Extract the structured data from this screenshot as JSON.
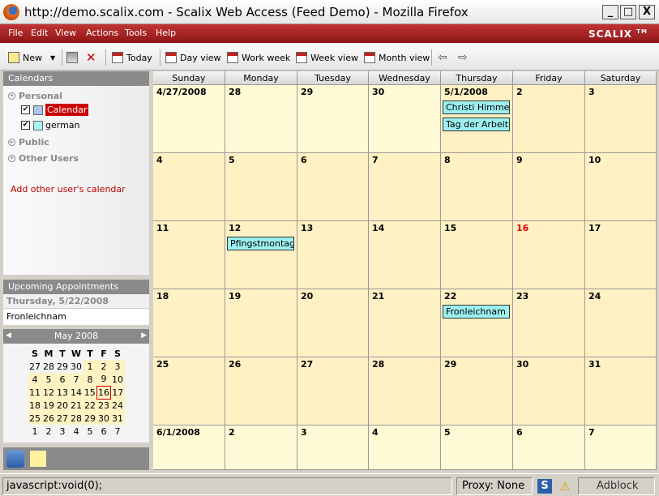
{
  "window": {
    "title": "http://demo.scalix.com - Scalix Web Access (Feed Demo) - Mozilla Firefox",
    "min": "_",
    "max": "□",
    "close": "X"
  },
  "menu": [
    "File",
    "Edit",
    "View",
    "Actions",
    "Tools",
    "Help"
  ],
  "brand": "SCALIX",
  "brand_tm": "TM",
  "toolbar": {
    "new": "New",
    "today": "Today",
    "day": "Day view",
    "workweek": "Work week",
    "week": "Week view",
    "month": "Month view"
  },
  "sidebar": {
    "header": "Calendars",
    "personal": "Personal",
    "calendars": [
      {
        "label": "Calendar",
        "color": "#a9c8ee"
      },
      {
        "label": "german",
        "color": "#a8f4f4"
      }
    ],
    "public": "Public",
    "other": "Other Users",
    "add_other": "Add other user's calendar"
  },
  "upcoming": {
    "header": "Upcoming Appointments",
    "date": "Thursday, 5/22/2008",
    "item": "Fronleichnam"
  },
  "mini_cal": {
    "month": "May 2008",
    "days": [
      "S",
      "M",
      "T",
      "W",
      "T",
      "F",
      "S"
    ],
    "weeks": [
      [
        "27",
        "28",
        "29",
        "30",
        "1",
        "2",
        "3"
      ],
      [
        "4",
        "5",
        "6",
        "7",
        "8",
        "9",
        "10"
      ],
      [
        "11",
        "12",
        "13",
        "14",
        "15",
        "16",
        "17"
      ],
      [
        "18",
        "19",
        "20",
        "21",
        "22",
        "23",
        "24"
      ],
      [
        "25",
        "26",
        "27",
        "28",
        "29",
        "30",
        "31"
      ],
      [
        "1",
        "2",
        "3",
        "4",
        "5",
        "6",
        "7"
      ]
    ]
  },
  "calendar": {
    "headers": [
      "Sunday",
      "Monday",
      "Tuesday",
      "Wednesday",
      "Thursday",
      "Friday",
      "Saturday"
    ],
    "weeks": [
      [
        "4/27/2008",
        "28",
        "29",
        "30",
        "5/1/2008",
        "2",
        "3"
      ],
      [
        "4",
        "5",
        "6",
        "7",
        "8",
        "9",
        "10"
      ],
      [
        "11",
        "12",
        "13",
        "14",
        "15",
        "16",
        "17"
      ],
      [
        "18",
        "19",
        "20",
        "21",
        "22",
        "23",
        "24"
      ],
      [
        "25",
        "26",
        "27",
        "28",
        "29",
        "30",
        "31"
      ],
      [
        "6/1/2008",
        "2",
        "3",
        "4",
        "5",
        "6",
        "7"
      ]
    ],
    "events": {
      "e1": "Christi Himmelfahrt",
      "e2": "Tag der Arbeit",
      "e3": "Pfingstmontag",
      "e4": "Fronleichnam"
    }
  },
  "status": {
    "text": "javascript:void(0);",
    "proxy": "Proxy: None",
    "s": "S",
    "warn": "⚠",
    "adblock": "Adblock"
  }
}
